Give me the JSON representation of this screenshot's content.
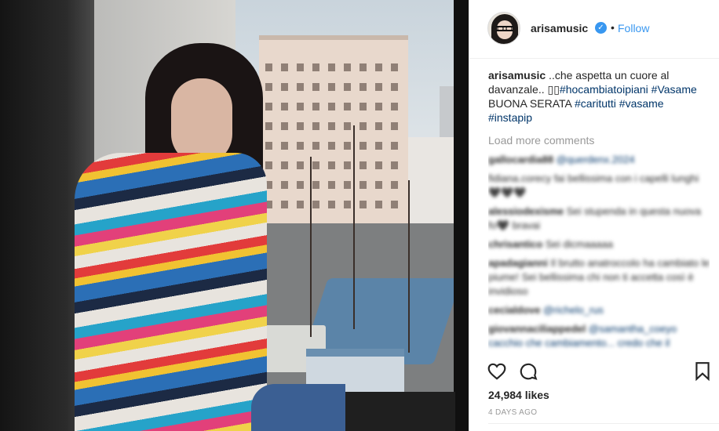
{
  "post": {
    "username": "arisamusic",
    "verified_icon": "verified-badge-icon",
    "separator": "•",
    "follow_label": "Follow",
    "caption": {
      "user": "arisamusic",
      "text_1": " ..che aspetta un cuore al davanzale.. ",
      "emoji": "▯▯",
      "tag_1": "#hocambiatoipiani",
      "space_1": " ",
      "tag_2": "#Vasame",
      "text_2": " BUONA SERATA ",
      "tag_3": "#caritutti",
      "space_2": " ",
      "tag_4": "#vasame",
      "space_3": " ",
      "tag_5": "#instapip"
    },
    "load_more_label": "Load more comments",
    "comments": [
      {
        "user": "gallocardia88",
        "text": " @querdenx.2024"
      },
      {
        "user": "",
        "text": "fidiana.corecy fai bellissima con i capelli lunghi 🖤🖤🖤"
      },
      {
        "user": "alessiodexisme",
        "text": " Sei stupenda in questa nuova fo🖤 bravai"
      },
      {
        "user": "chrisantico",
        "text": " Sei dicmaaaaa"
      },
      {
        "user": "apadagianni",
        "text": " Il brutto anatroccolo ha cambiato le piume! Sei bellissima chi non ti accetta così è invidioso"
      },
      {
        "user": "cecialdove",
        "text": " @richelo_rus"
      },
      {
        "user": "giovannaciliappedel",
        "text": " @samantha_coeyo cacchio che cambiamento... credo che il"
      }
    ],
    "likes": "24,984 likes",
    "time_ago": "4 DAYS AGO",
    "icons": {
      "like": "heart-icon",
      "comment": "comment-bubble-icon",
      "save": "bookmark-icon"
    },
    "colors": {
      "link": "#3897f0",
      "hashtag": "#003569",
      "muted": "#999999",
      "text": "#262626"
    }
  }
}
